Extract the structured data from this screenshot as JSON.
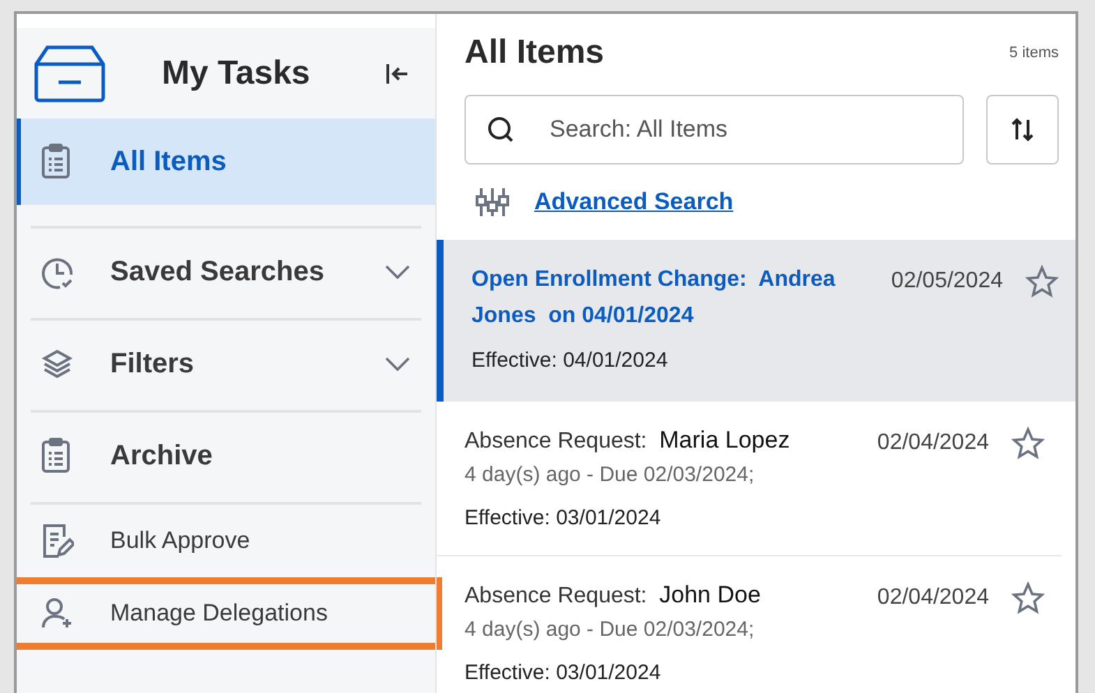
{
  "sidebar": {
    "title": "My Tasks",
    "items": [
      {
        "label": "All Items",
        "kind": "section",
        "selected": true,
        "highlighted": false
      },
      {
        "label": "Saved Searches",
        "kind": "group",
        "selected": false,
        "expanded": false,
        "highlighted": false
      },
      {
        "label": "Filters",
        "kind": "group",
        "selected": false,
        "expanded": false,
        "highlighted": false
      },
      {
        "label": "Archive",
        "kind": "section",
        "selected": false,
        "highlighted": false
      },
      {
        "label": "Bulk Approve",
        "kind": "action",
        "selected": false,
        "highlighted": false
      },
      {
        "label": "Manage Delegations",
        "kind": "action",
        "selected": false,
        "highlighted": true
      }
    ]
  },
  "main": {
    "title": "All Items",
    "count": "5 items",
    "search": {
      "placeholder": "Search: All Items"
    },
    "advanced_search": "Advanced Search",
    "tasks": [
      {
        "type": "Open Enrollment Change:",
        "subject": "Andrea Jones",
        "suffix": "on 04/01/2024",
        "date": "02/05/2024",
        "effective": "Effective: 04/01/2024",
        "selected": true
      },
      {
        "type": "Absence Request:",
        "subject": "Maria Lopez",
        "due": "4 day(s) ago - Due 02/03/2024;",
        "date": "02/04/2024",
        "effective": "Effective: 03/01/2024",
        "selected": false
      },
      {
        "type": "Absence Request:",
        "subject": "John Doe",
        "due": "4 day(s) ago - Due 02/03/2024;",
        "date": "02/04/2024",
        "effective": "Effective: 03/01/2024",
        "selected": false
      }
    ]
  }
}
